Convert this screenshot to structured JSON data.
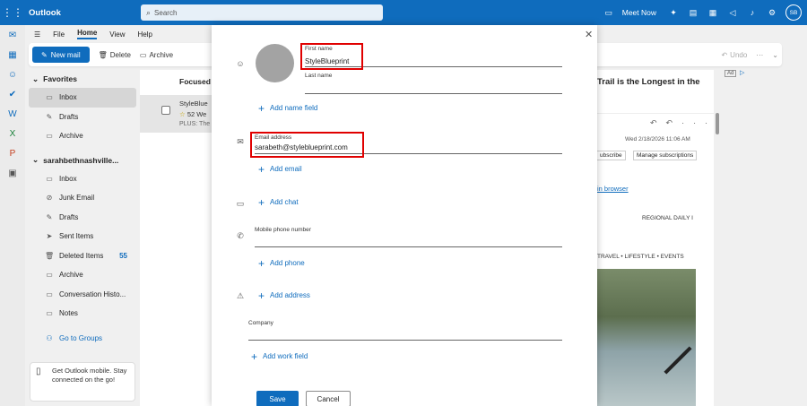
{
  "topbar": {
    "app_title": "Outlook",
    "search_placeholder": "Search",
    "meet_now": "Meet Now",
    "avatar_initials": "SB"
  },
  "ribbon": {
    "tabs": [
      "File",
      "Home",
      "View",
      "Help"
    ],
    "new_mail": "New mail",
    "delete": "Delete",
    "archive": "Archive",
    "undo": "Undo"
  },
  "folders": {
    "favorites_label": "Favorites",
    "favorites": [
      {
        "label": "Inbox",
        "icon": "inbox-icon"
      },
      {
        "label": "Drafts",
        "icon": "drafts-icon"
      },
      {
        "label": "Archive",
        "icon": "archive-icon"
      }
    ],
    "account_label": "sarahbethnashville...",
    "account_items": [
      {
        "label": "Inbox",
        "icon": "inbox-icon",
        "count": ""
      },
      {
        "label": "Junk Email",
        "icon": "junk-icon",
        "count": ""
      },
      {
        "label": "Drafts",
        "icon": "drafts-icon",
        "count": ""
      },
      {
        "label": "Sent Items",
        "icon": "sent-icon",
        "count": ""
      },
      {
        "label": "Deleted Items",
        "icon": "trash-icon",
        "count": "55"
      },
      {
        "label": "Archive",
        "icon": "archive-icon",
        "count": ""
      },
      {
        "label": "Conversation Histo...",
        "icon": "folder-icon",
        "count": ""
      },
      {
        "label": "Notes",
        "icon": "folder-icon",
        "count": ""
      }
    ],
    "go_to_groups": "Go to Groups",
    "mobile_promo": "Get Outlook mobile. Stay connected on the go!"
  },
  "message_list": {
    "header": "Focused",
    "row": {
      "sender": "StyleBlue",
      "line2": "52 We",
      "line3": "PLUS: The"
    }
  },
  "reading_pane": {
    "ad_title": "Trail is the Longest in the",
    "ad_tag": "Ad",
    "date": "Wed 2/18/2026 11:06 AM",
    "unsubscribe": "ubscribe",
    "manage_subscriptions": "Manage subscriptions",
    "view_in_browser": "in browser",
    "regional": "REGIONAL DAILY I",
    "travel_line": "TRAVEL  •  LIFESTYLE  •  EVENTS"
  },
  "dialog": {
    "first_name_label": "First name",
    "first_name_value": "StyleBlueprint",
    "last_name_label": "Last name",
    "last_name_value": "",
    "add_name_field": "Add name field",
    "email_label": "Email address",
    "email_value": "sarabeth@styleblueprint.com",
    "add_email": "Add email",
    "add_chat": "Add chat",
    "mobile_label": "Mobile phone number",
    "add_phone": "Add phone",
    "add_address": "Add address",
    "company_label": "Company",
    "add_work_field": "Add work field",
    "save": "Save",
    "cancel": "Cancel"
  },
  "colors": {
    "brand": "#0f6cbd",
    "highlight": "#e00000"
  }
}
